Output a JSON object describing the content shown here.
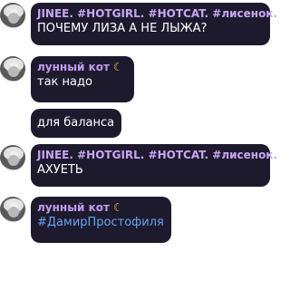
{
  "messages": [
    {
      "author": "JINEE. #HOTGIRL. #HOTCAT. #лисенок.",
      "text": "ПОЧЕМУ ЛИЗА А НЕ ЛЫЖА?"
    },
    {
      "author": "лунный кот",
      "author_icon": "crescent-moon-icon",
      "text": "так надо"
    },
    {
      "text": "для баланса"
    },
    {
      "author": "JINEE. #HOTGIRL. #HOTCAT. #лисенок.",
      "text": "АХУЕТЬ"
    },
    {
      "author": "лунный кот",
      "author_icon": "crescent-moon-icon",
      "text": "#ДамирПростофиля"
    }
  ],
  "colors": {
    "bubble_bg": "#1e1a2e",
    "name_color": "#c8a6f5",
    "hashtag_color": "#63a3f0",
    "moon_color": "#f1c14a"
  }
}
